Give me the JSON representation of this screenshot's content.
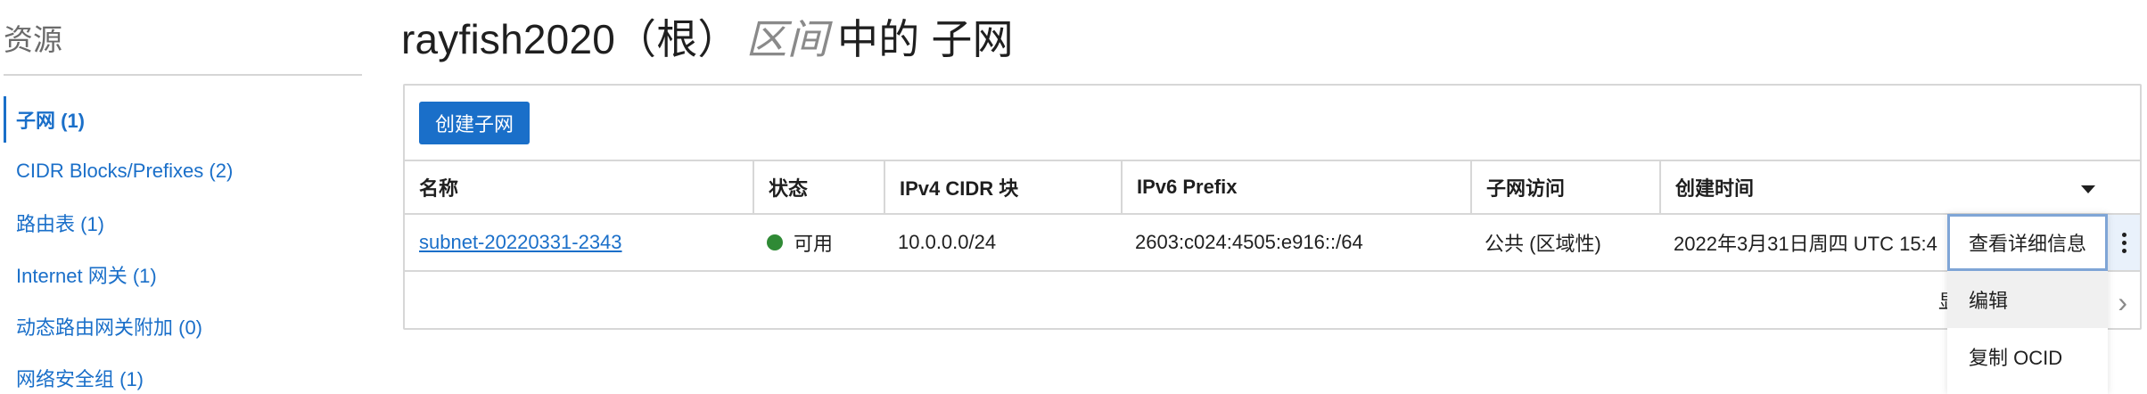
{
  "sidebar": {
    "title": "资源",
    "items": [
      {
        "label": "子网 (1)",
        "active": true
      },
      {
        "label": "CIDR Blocks/Prefixes (2)",
        "active": false
      },
      {
        "label": "路由表 (1)",
        "active": false
      },
      {
        "label": "Internet 网关 (1)",
        "active": false
      },
      {
        "label": "动态路由网关附加 (0)",
        "active": false
      },
      {
        "label": "网络安全组 (1)",
        "active": false
      }
    ]
  },
  "header": {
    "title_prefix": "rayfish2020（根）",
    "title_italic": "区间",
    "title_suffix": "中的 子网"
  },
  "toolbar": {
    "create_label": "创建子网"
  },
  "table": {
    "columns": [
      "名称",
      "状态",
      "IPv4 CIDR 块",
      "IPv6 Prefix",
      "子网访问",
      "创建时间"
    ],
    "rows": [
      {
        "name": "subnet-20220331-2343",
        "status": "可用",
        "ipv4": "10.0.0.0/24",
        "ipv6": "2603:c024:4505:e916::/64",
        "access": "公共 (区域性)",
        "created": "2022年3月31日周四 UTC 15:4"
      }
    ]
  },
  "footer": {
    "partial_text": "显",
    "next_glyph": "›"
  },
  "menu": {
    "items": [
      "查看详细信息",
      "编辑",
      "复制 OCID"
    ]
  },
  "colors": {
    "accent": "#1a6fc9",
    "status_ok": "#2f8a35",
    "border": "#d7d7d7"
  }
}
